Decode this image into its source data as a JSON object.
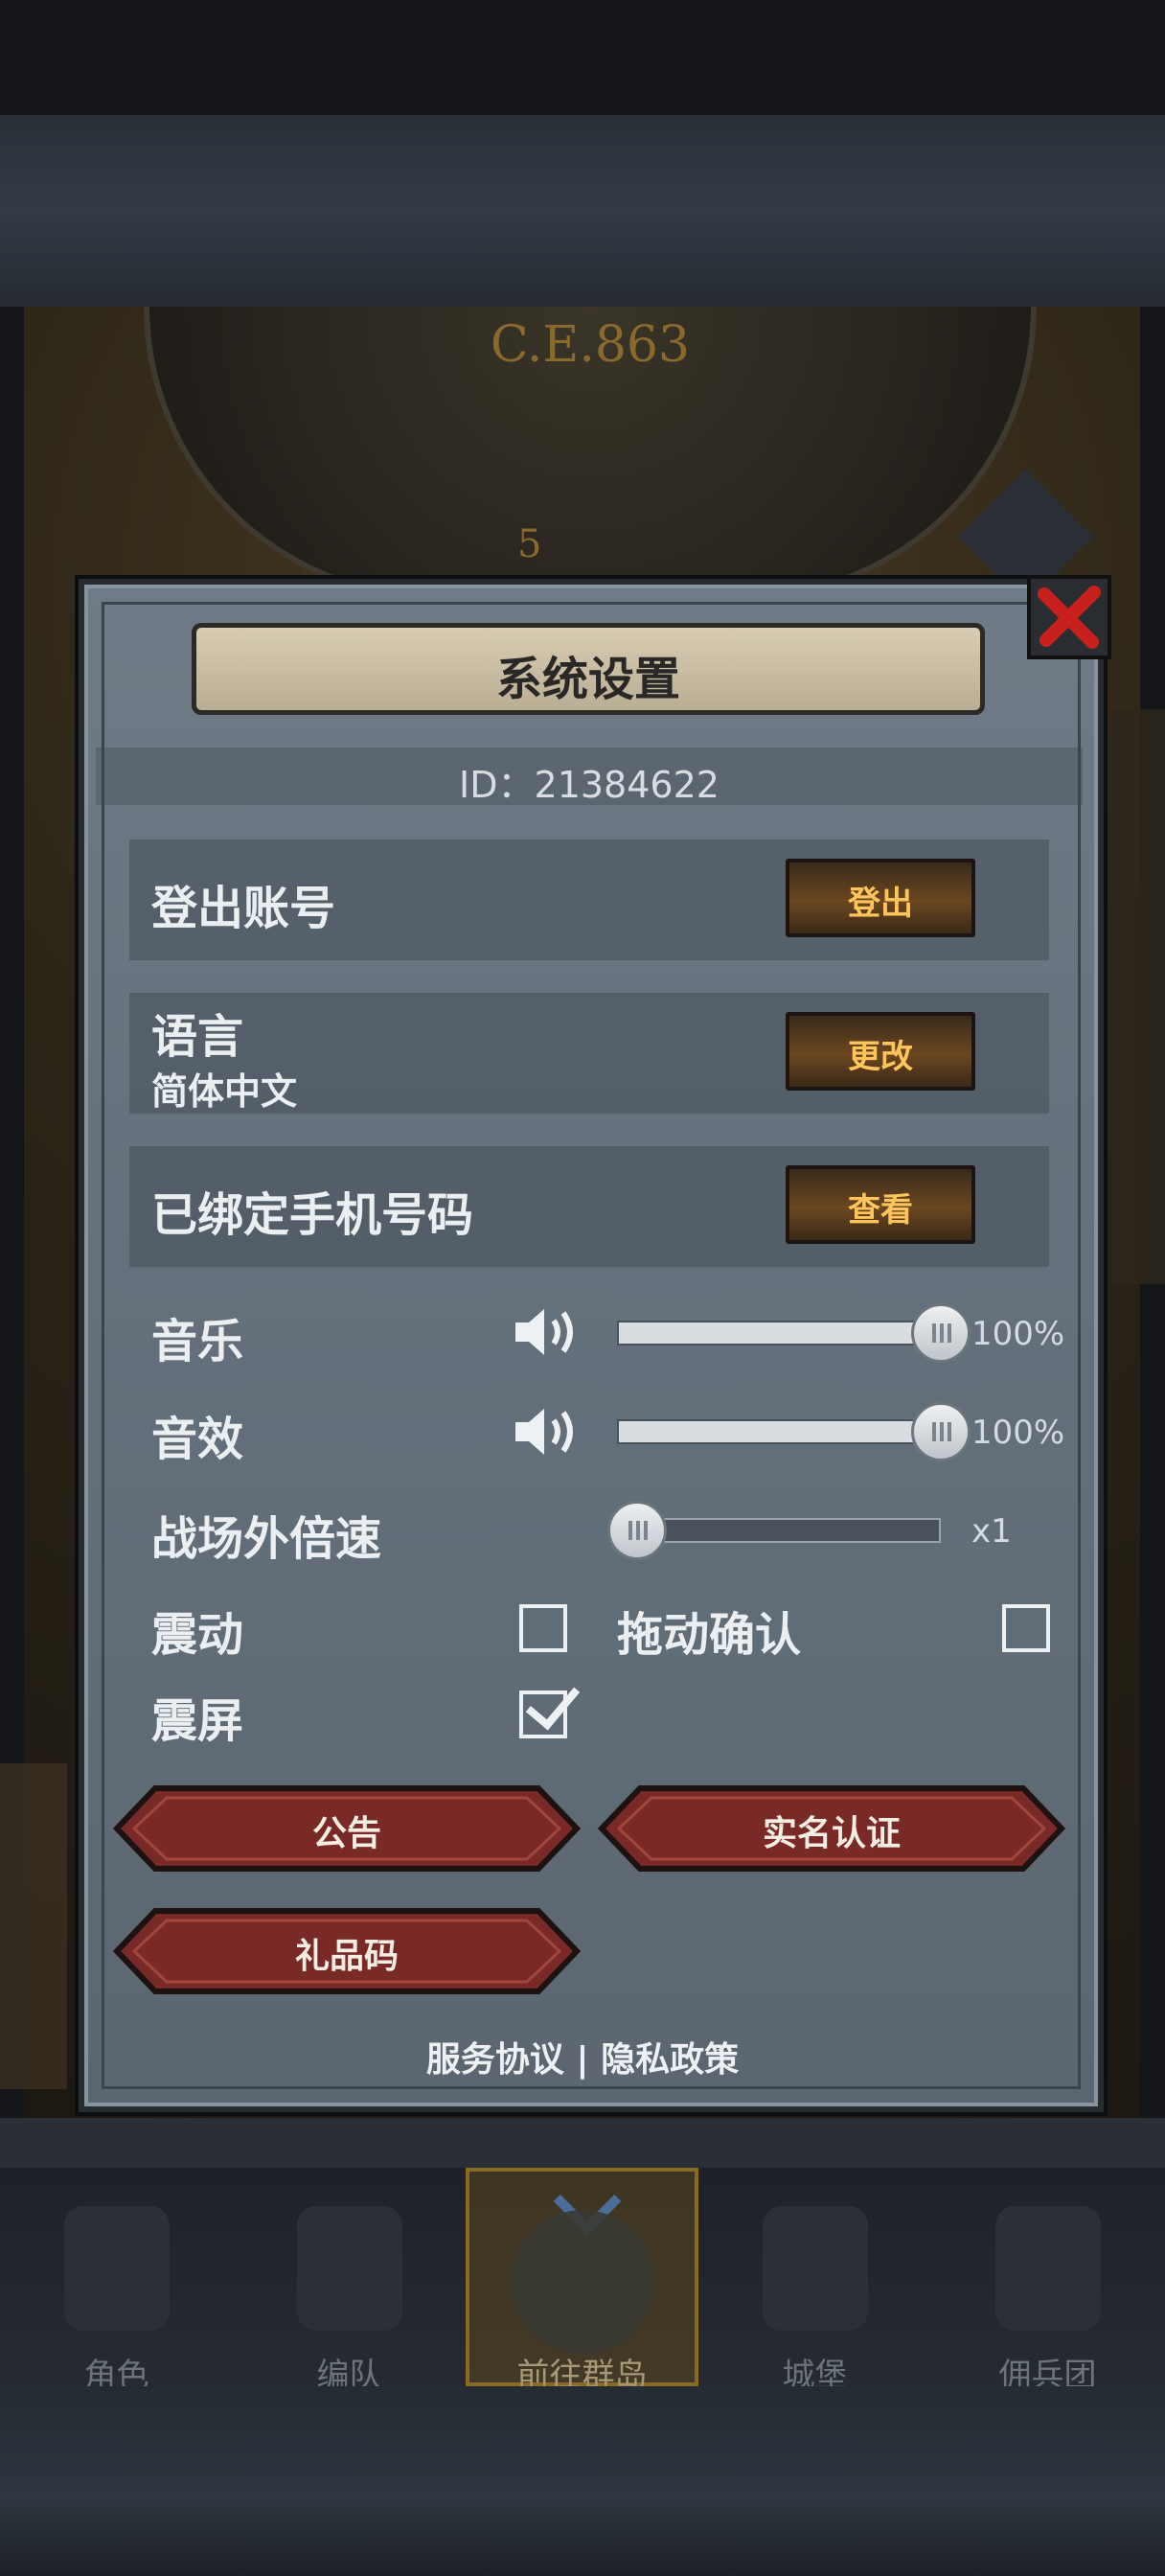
{
  "background": {
    "year_text": "C.E.863",
    "dial_number": "5"
  },
  "dialog": {
    "title": "系统设置",
    "id_text": "ID：21384622",
    "rows": {
      "logout": {
        "label": "登出账号",
        "button": "登出"
      },
      "language": {
        "label": "语言",
        "value": "简体中文",
        "button": "更改"
      },
      "phone": {
        "label": "已绑定手机号码",
        "button": "查看"
      }
    },
    "music": {
      "label": "音乐",
      "value_text": "100%",
      "level": 1.0
    },
    "sfx": {
      "label": "音效",
      "value_text": "100%",
      "level": 1.0
    },
    "speed": {
      "label": "战场外倍速",
      "value_text": "x1",
      "level": 0.0
    },
    "vibration": {
      "label": "震动",
      "checked": false
    },
    "drag_confirm": {
      "label": "拖动确认",
      "checked": false
    },
    "screen_shake": {
      "label": "震屏",
      "checked": true
    },
    "buttons": {
      "notice": "公告",
      "real_name": "实名认证",
      "gift_code": "礼品码"
    },
    "footer": {
      "service": "服务协议",
      "separator": "|",
      "privacy": "隐私政策"
    }
  },
  "bottom_nav": [
    {
      "label": "角色"
    },
    {
      "label": "编队"
    },
    {
      "label": "前往群岛",
      "active": true
    },
    {
      "label": "城堡"
    },
    {
      "label": "佣兵团"
    }
  ],
  "colors": {
    "gold_button_text": "#ffc45a",
    "red_button": "#7a2a26",
    "close_x": "#c8201c"
  }
}
